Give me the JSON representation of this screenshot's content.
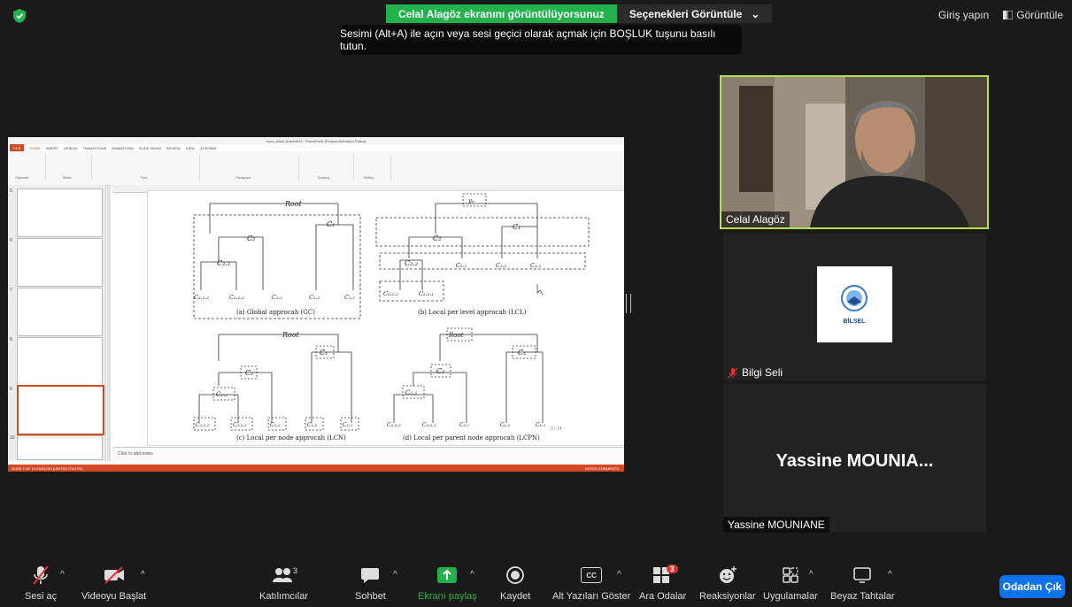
{
  "banner": {
    "sharing_text": "Celal Alagöz ekranını görüntülüyorsunuz",
    "options_label": "Seçenekleri Görüntüle"
  },
  "tooltip": "Sesimi (Alt+A) ile açın veya sesi geçici olarak açmak için BOŞLUK tuşunu basılı tutun.",
  "top_right": {
    "signin": "Giriş yapın",
    "view": "Görüntüle"
  },
  "ppt": {
    "title": "sunu_bilsel_kvadrile23 - PowerPoint (Product Activation Failed)",
    "tabs": [
      "FILE",
      "HOME",
      "INSERT",
      "DESIGN",
      "TRANSITIONS",
      "ANIMATIONS",
      "SLIDE SHOW",
      "REVIEW",
      "VIEW",
      "ACROBAT"
    ],
    "ribbon_groups": [
      "Clipboard",
      "Slides",
      "Font",
      "Paragraph",
      "Drawing",
      "Editing"
    ],
    "thumb_numbers": [
      "5",
      "6",
      "7",
      "8",
      "9",
      "10"
    ],
    "notes_placeholder": "Click to add notes",
    "status_left": "SLIDE 9 OF 14    ENGLISH (UNITED STATES)",
    "status_right": "NOTES    COMMENTS",
    "page_num": "9 / 14",
    "captions": {
      "a": "(a) Global approcah (GC)",
      "b": "(b) Local per level approcah (LCL)",
      "c": "(c) Local per node approcah (LCN)",
      "d": "(d) Local per parent node approcah (LCPN)"
    }
  },
  "participants": {
    "cam_name": "Celal Alagöz",
    "tile2_name": "Bilgi Seli",
    "tile2_logo": "BİLSEL",
    "tile3_big": "Yassine  MOUNIA...",
    "tile3_name": "Yassine MOUNIANE"
  },
  "toolbar": {
    "mute": "Sesi aç",
    "video": "Videoyu Başlat",
    "participants": "Katılımcılar",
    "participants_count": "3",
    "chat": "Sohbet",
    "share": "Ekranı paylaş",
    "record": "Kaydet",
    "captions": "Alt Yazıları Göster",
    "captions_icon": "CC",
    "breakout": "Ara Odalar",
    "breakout_badge": "3",
    "reactions": "Reaksiyonlar",
    "apps": "Uygulamalar",
    "whiteboard": "Beyaz Tahtalar",
    "leave": "Odadan Çık"
  },
  "colors": {
    "share_green": "#22b14c",
    "leave_blue": "#0e72ed",
    "active_speaker": "#b6e04a",
    "ppt_accent": "#d04a25"
  }
}
